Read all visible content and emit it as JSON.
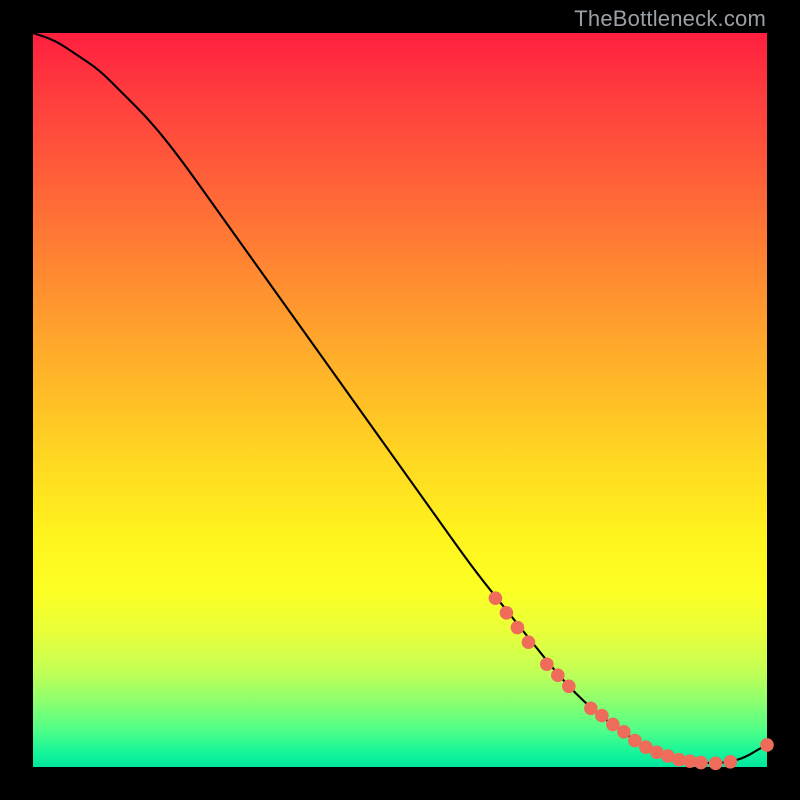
{
  "watermark": "TheBottleneck.com",
  "colors": {
    "background": "#000000",
    "gradient_top": "#ff1f3f",
    "gradient_bottom": "#00e69f",
    "curve": "#000000",
    "marker_fill": "#ef6b5a",
    "marker_stroke": "#ef6b5a"
  },
  "chart_data": {
    "type": "line",
    "title": "",
    "xlabel": "",
    "ylabel": "",
    "xlim": [
      0,
      100
    ],
    "ylim": [
      0,
      100
    ],
    "grid": false,
    "series": [
      {
        "name": "curve",
        "x": [
          0,
          3,
          6,
          9,
          12,
          16,
          20,
          25,
          30,
          35,
          40,
          45,
          50,
          55,
          60,
          64,
          68,
          72,
          76,
          80,
          83,
          85,
          87,
          89,
          91,
          93,
          95,
          97,
          99,
          100
        ],
        "y": [
          100,
          99,
          97,
          95,
          92,
          88,
          83,
          76,
          69,
          62,
          55,
          48,
          41,
          34,
          27,
          22,
          17,
          12,
          8,
          5,
          3,
          2,
          1.3,
          0.8,
          0.6,
          0.5,
          0.7,
          1.3,
          2.5,
          3.0
        ]
      }
    ],
    "markers": [
      {
        "x": 63,
        "y": 23.0
      },
      {
        "x": 64.5,
        "y": 21.0
      },
      {
        "x": 66,
        "y": 19.0
      },
      {
        "x": 67.5,
        "y": 17.0
      },
      {
        "x": 70,
        "y": 14.0
      },
      {
        "x": 71.5,
        "y": 12.5
      },
      {
        "x": 73,
        "y": 11.0
      },
      {
        "x": 76,
        "y": 8.0
      },
      {
        "x": 77.5,
        "y": 7.0
      },
      {
        "x": 79,
        "y": 5.8
      },
      {
        "x": 80.5,
        "y": 4.8
      },
      {
        "x": 82,
        "y": 3.6
      },
      {
        "x": 83.5,
        "y": 2.7
      },
      {
        "x": 85,
        "y": 2.0
      },
      {
        "x": 86.5,
        "y": 1.5
      },
      {
        "x": 88,
        "y": 1.0
      },
      {
        "x": 89.5,
        "y": 0.8
      },
      {
        "x": 91,
        "y": 0.6
      },
      {
        "x": 93,
        "y": 0.5
      },
      {
        "x": 95,
        "y": 0.7
      },
      {
        "x": 100,
        "y": 3.0
      }
    ],
    "annotations": []
  }
}
